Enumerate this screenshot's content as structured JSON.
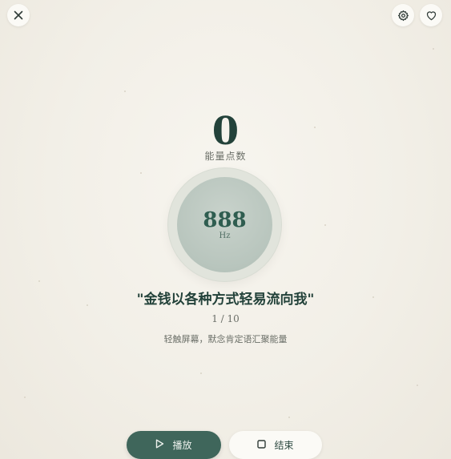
{
  "top_bar": {
    "close_icon": "close-icon",
    "settings_icon": "gear-icon",
    "favorite_icon": "heart-icon"
  },
  "score": {
    "value": "0",
    "label": "能量点数"
  },
  "orb": {
    "frequency": "888",
    "unit": "Hz"
  },
  "affirmation": {
    "text": "\"金钱以各种方式轻易流向我\"",
    "progress": "1 / 10",
    "hint": "轻触屏幕，默念肯定语汇聚能量"
  },
  "controls": {
    "play_label": "播放",
    "play_icon": "play-icon",
    "stop_label": "结束",
    "stop_icon": "stop-icon"
  },
  "colors": {
    "primary": "#3f665b",
    "text_dark": "#23423a",
    "background": "#f2efe7"
  }
}
